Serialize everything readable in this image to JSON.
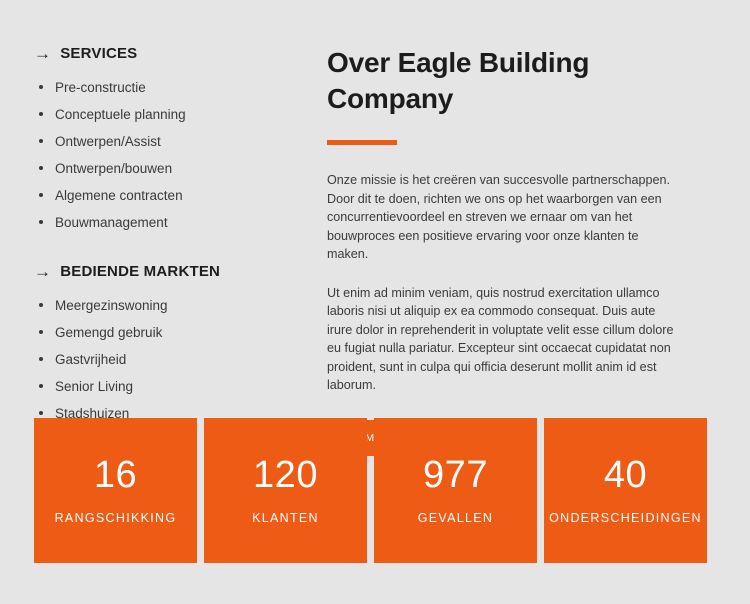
{
  "background_color": "#e5e5e5",
  "accent_color": "#ee5b14",
  "sidebar": {
    "services": {
      "arrow_icon": "→",
      "heading": "SERVICES",
      "items": [
        {
          "label": "Pre-constructie"
        },
        {
          "label": "Conceptuele planning"
        },
        {
          "label": "Ontwerpen/Assist"
        },
        {
          "label": "Ontwerpen/bouwen"
        },
        {
          "label": "Algemene contracten"
        },
        {
          "label": "Bouwmanagement"
        }
      ]
    },
    "markets": {
      "arrow_icon": "→",
      "heading": "BEDIENDE MARKTEN",
      "items": [
        {
          "label": "Meergezinswoning"
        },
        {
          "label": "Gemengd gebruik"
        },
        {
          "label": "Gastvrijheid"
        },
        {
          "label": "Senior Living"
        },
        {
          "label": "Stadshuizen"
        }
      ]
    }
  },
  "main": {
    "title": "Over Eagle Building Company",
    "paragraph_1": "Onze missie is het creëren van succesvolle partnerschappen. Door dit te doen, richten we ons op het waarborgen van een concurrentievoordeel en streven we ernaar om van het bouwproces een positieve ervaring voor onze klanten te maken.",
    "paragraph_2": "Ut enim ad minim veniam, quis nostrud exercitation ullamco laboris nisi ut aliquip ex ea commodo consequat. Duis aute irure dolor in reprehenderit in voluptate velit esse cillum dolore eu fugiat nulla pariatur. Excepteur sint occaecat cupidatat non proident, sunt in culpa qui officia deserunt mollit anim id est laborum.",
    "cta_label": "NEEM CONTACT OP"
  },
  "stats": [
    {
      "value": "16",
      "label": "RANGSCHIKKING"
    },
    {
      "value": "120",
      "label": "KLANTEN"
    },
    {
      "value": "977",
      "label": "GEVALLEN"
    },
    {
      "value": "40",
      "label": "ONDERSCHEIDINGEN"
    }
  ]
}
